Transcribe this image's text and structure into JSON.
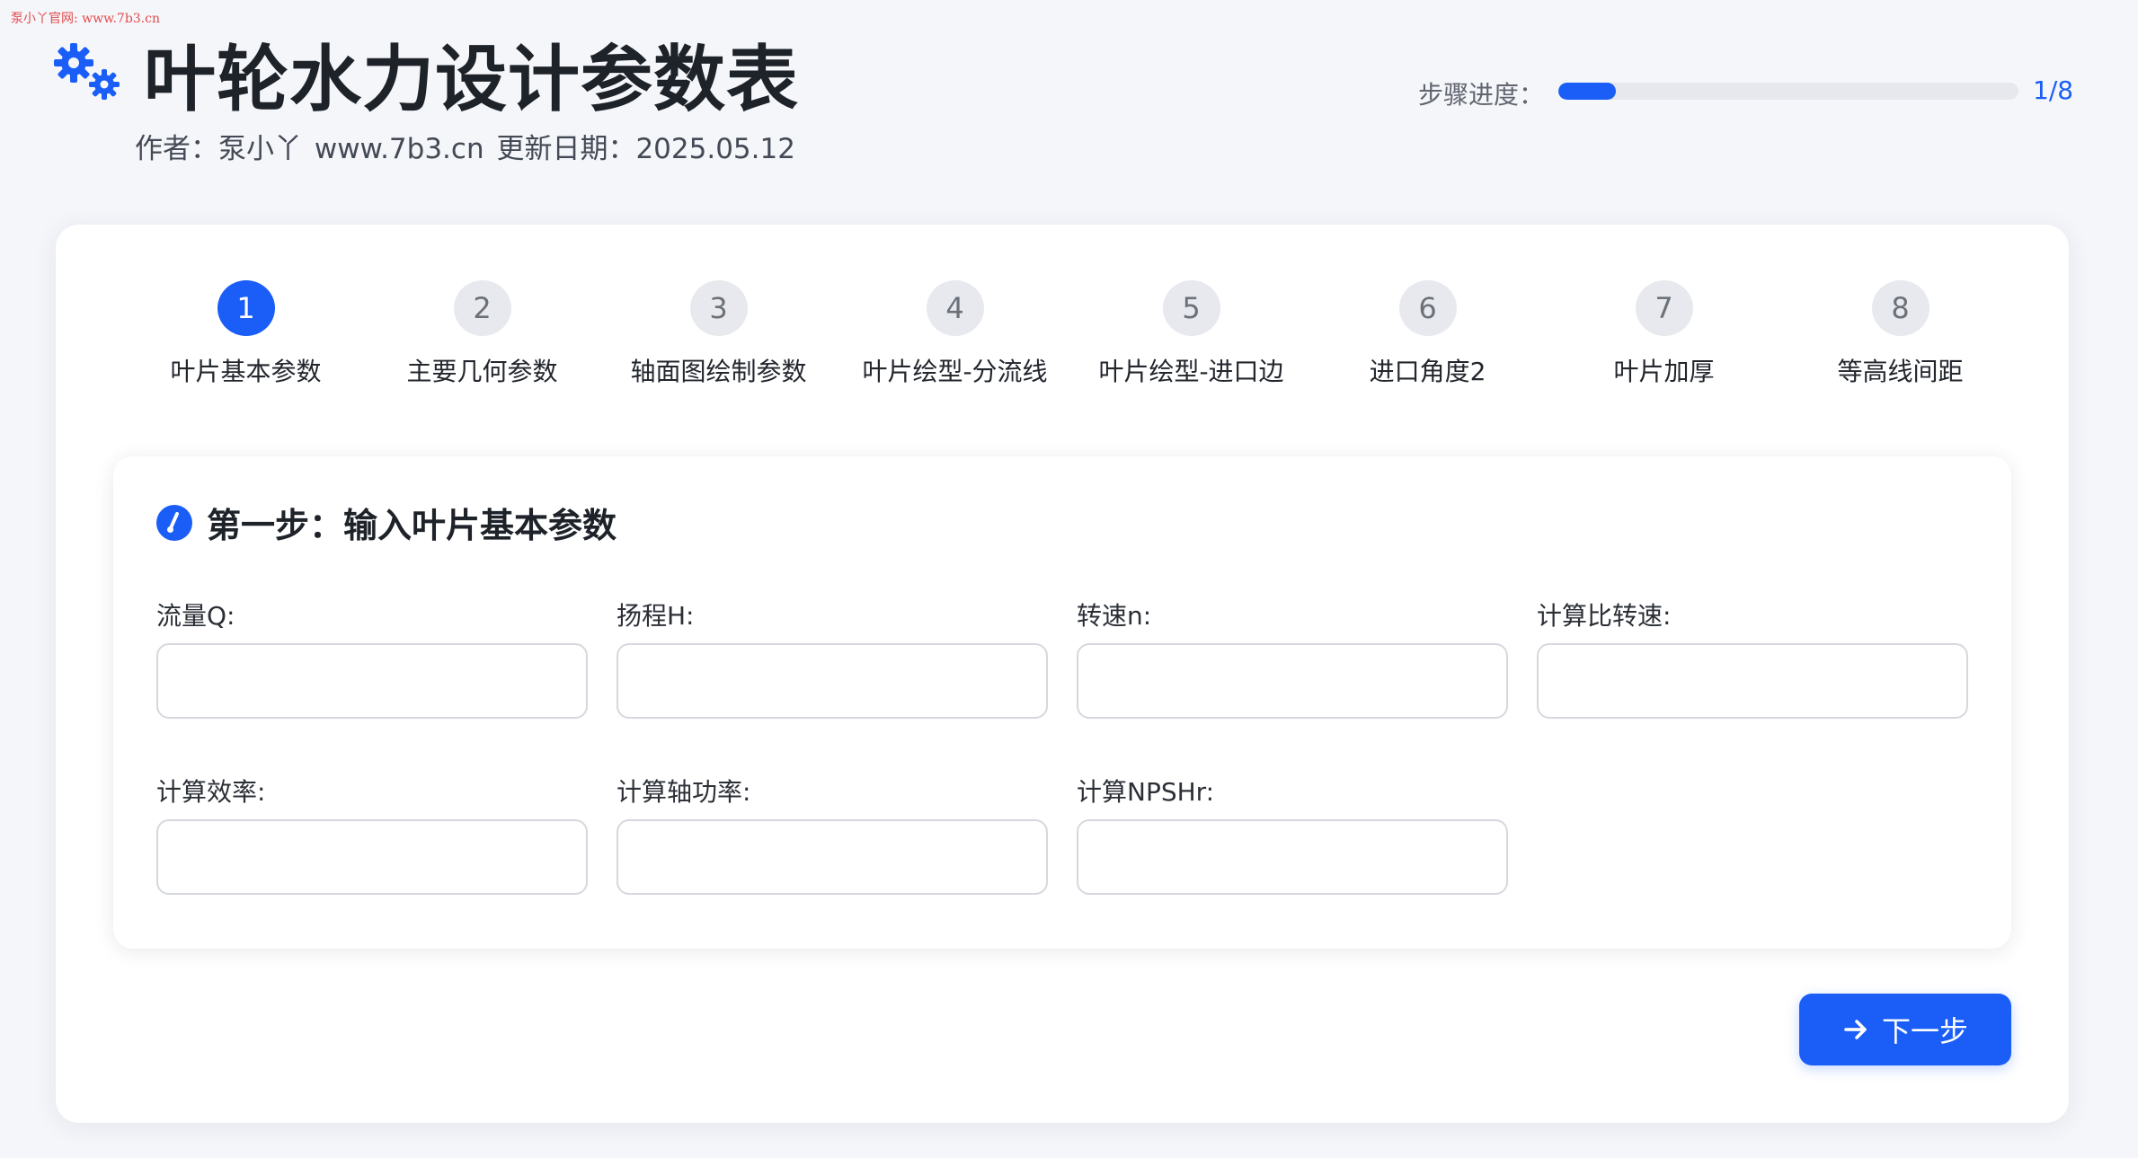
{
  "watermark": "泵小丫官网: www.7b3.cn",
  "header": {
    "icon": "gears-icon",
    "title": "叶轮水力设计参数表",
    "subtitle": "作者：泵小丫 www.7b3.cn   更新日期：2025.05.12"
  },
  "progress": {
    "label": "步骤进度：",
    "current": 1,
    "total": 8,
    "fraction": 0.125,
    "text": "1/8"
  },
  "steps": [
    {
      "number": "1",
      "label": "叶片基本参数",
      "active": true
    },
    {
      "number": "2",
      "label": "主要几何参数",
      "active": false
    },
    {
      "number": "3",
      "label": "轴面图绘制参数",
      "active": false
    },
    {
      "number": "4",
      "label": "叶片绘型-分流线",
      "active": false
    },
    {
      "number": "5",
      "label": "叶片绘型-进口边",
      "active": false
    },
    {
      "number": "6",
      "label": "进口角度2",
      "active": false
    },
    {
      "number": "7",
      "label": "叶片加厚",
      "active": false
    },
    {
      "number": "8",
      "label": "等高线间距",
      "active": false
    }
  ],
  "section": {
    "icon": "gauge-icon",
    "title": "第一步：输入叶片基本参数"
  },
  "fields": [
    {
      "label": "流量Q:",
      "value": ""
    },
    {
      "label": "扬程H:",
      "value": ""
    },
    {
      "label": "转速n:",
      "value": ""
    },
    {
      "label": "计算比转速:",
      "value": ""
    },
    {
      "label": "计算效率:",
      "value": ""
    },
    {
      "label": "计算轴功率:",
      "value": ""
    },
    {
      "label": "计算NPSHr:",
      "value": ""
    }
  ],
  "next_button": {
    "icon": "arrow-right-icon",
    "label": "下一步"
  },
  "colors": {
    "accent": "#1a5ef7",
    "background": "#f5f6fa",
    "inactive_step": "#e7e9ee"
  }
}
